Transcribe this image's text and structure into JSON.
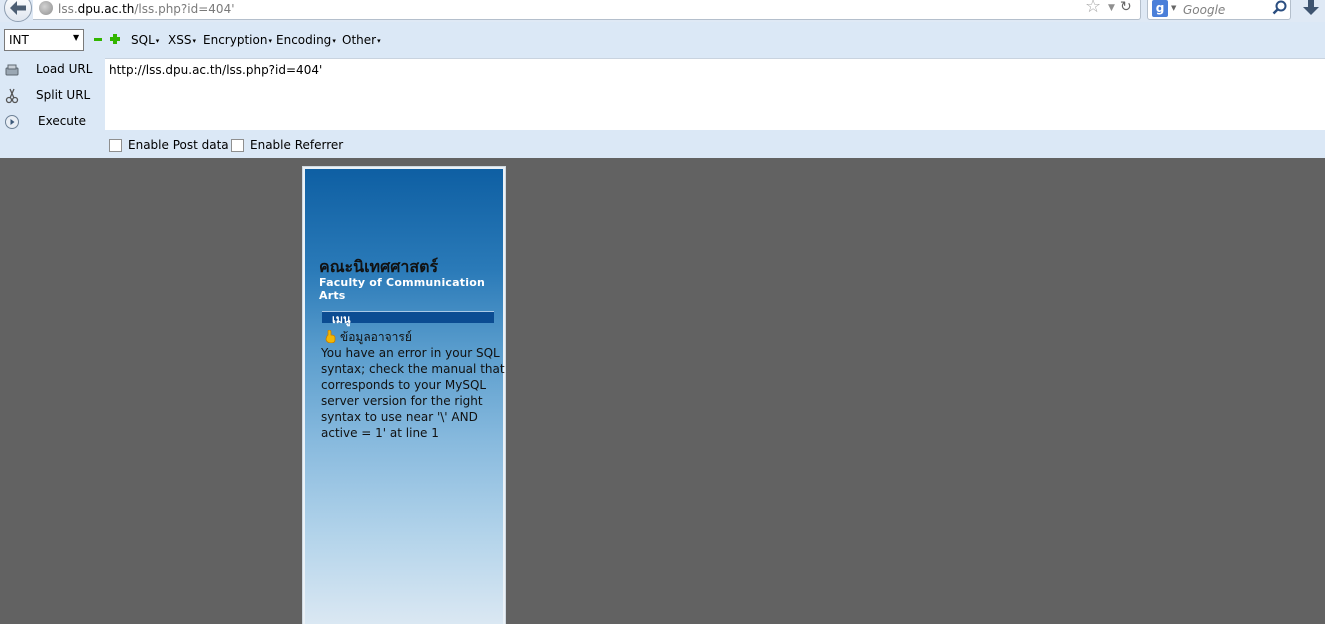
{
  "browser": {
    "url_prefix": "lss.",
    "url_domain": "dpu.ac.th",
    "url_path": "/lss.php?id=404'",
    "search_placeholder": "Google"
  },
  "hackbar": {
    "encoding_select": "INT",
    "menus": [
      "SQL",
      "XSS",
      "Encryption",
      "Encoding",
      "Other"
    ],
    "side_buttons": [
      "Load URL",
      "Split URL",
      "Execute"
    ],
    "url_value": "http://lss.dpu.ac.th/lss.php?id=404'",
    "enable_post": "Enable Post data",
    "enable_referrer": "Enable Referrer"
  },
  "page": {
    "faculty_thai": "คณะนิเทศศาสตร์",
    "faculty_english": "Faculty of Communication Arts",
    "menu_header": "เมนู",
    "menu_item": "ข้อมูลอาจารย์",
    "error_message": "You have an error in your SQL syntax; check the manual that corresponds to your MySQL server version for the right syntax to use near '\\' AND active = 1' at line 1"
  },
  "colors": {
    "toolbar_bg": "#dbe8f6",
    "page_bg": "#626262",
    "menu_bar": "#0b4c92"
  }
}
